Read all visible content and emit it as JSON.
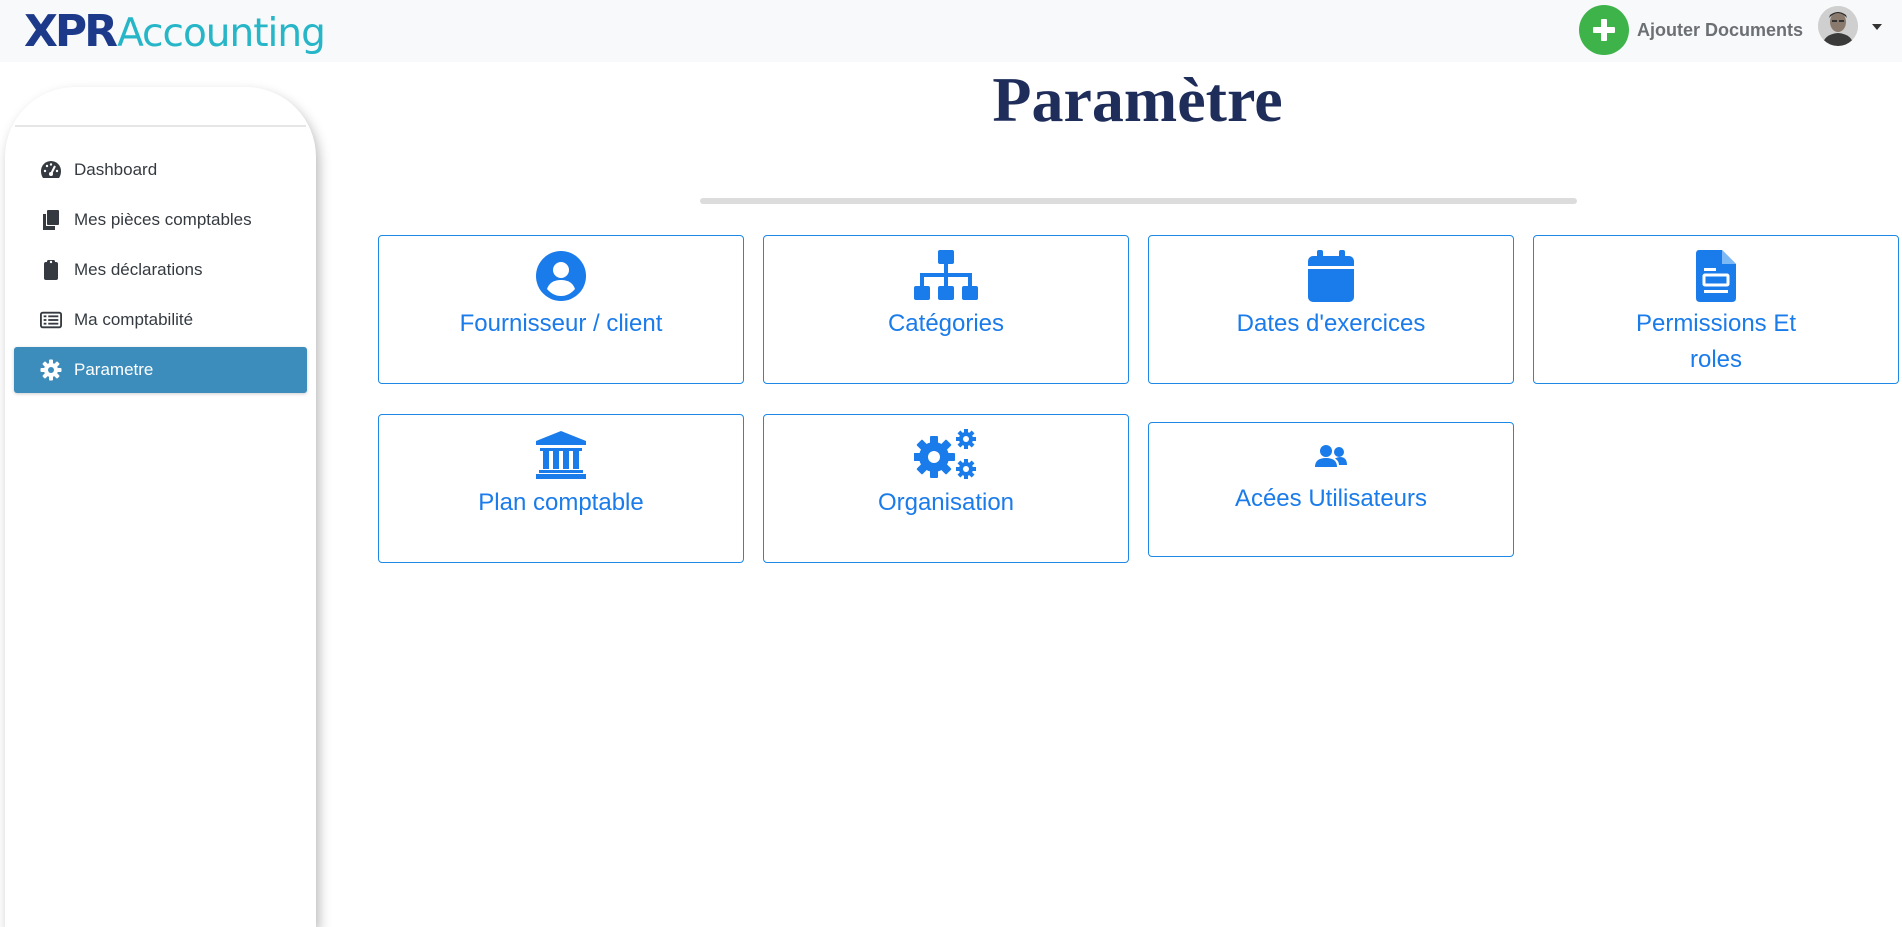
{
  "header": {
    "logo_part1": "XPR",
    "logo_part2": "Accounting",
    "add_documents_label": "Ajouter Documents"
  },
  "sidebar": {
    "items": [
      {
        "label": "Dashboard",
        "icon": "tachometer-icon",
        "active": false
      },
      {
        "label": "Mes pièces comptables",
        "icon": "copy-icon",
        "active": false
      },
      {
        "label": "Mes déclarations",
        "icon": "clipboard-icon",
        "active": false
      },
      {
        "label": "Ma comptabilité",
        "icon": "list-alt-icon",
        "active": false
      },
      {
        "label": "Parametre",
        "icon": "gear-icon",
        "active": true
      }
    ]
  },
  "main": {
    "title": "Paramètre",
    "cards": [
      {
        "label": "Fournisseur / client",
        "icon": "user-circle-icon"
      },
      {
        "label": "Catégories",
        "icon": "sitemap-icon"
      },
      {
        "label": "Dates d'exercices",
        "icon": "calendar-icon"
      },
      {
        "label_line1": "Permissions Et",
        "label_line2": "roles",
        "icon": "file-alt-icon"
      },
      {
        "label": "Plan comptable",
        "icon": "university-icon"
      },
      {
        "label": "Organisation",
        "icon": "cogs-icon"
      },
      {
        "label": "Acées Utilisateurs",
        "icon": "user-friends-icon"
      }
    ]
  },
  "colors": {
    "accent": "#1a7bea",
    "sidebar_active": "#3c8dbc",
    "add_button": "#3db34a",
    "title": "#1f2d5a"
  }
}
